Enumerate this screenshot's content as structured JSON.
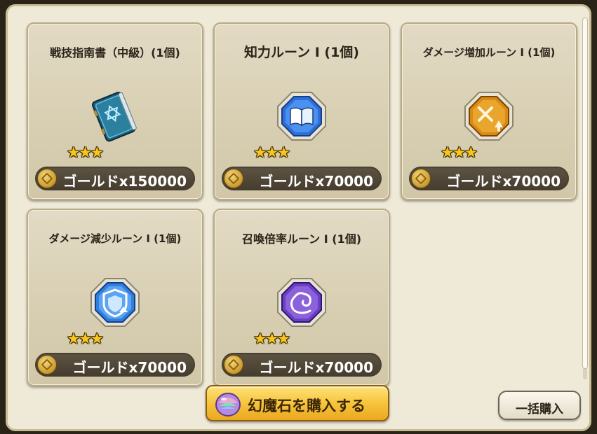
{
  "shop": {
    "items": [
      {
        "name": "戦技指南書（中級）(1個)",
        "stars": 3,
        "price": "ゴールドx150000",
        "icon": "blue-book-icon"
      },
      {
        "name": "知力ルーン I (1個)",
        "stars": 3,
        "price": "ゴールドx70000",
        "icon": "intellect-rune-icon"
      },
      {
        "name": "ダメージ増加ルーン I (1個)",
        "stars": 3,
        "price": "ゴールドx70000",
        "icon": "damage-up-rune-icon"
      },
      {
        "name": "ダメージ減少ルーン I (1個)",
        "stars": 3,
        "price": "ゴールドx70000",
        "icon": "damage-down-rune-icon"
      },
      {
        "name": "召喚倍率ルーン I (1個)",
        "stars": 3,
        "price": "ゴールドx70000",
        "icon": "summon-rate-rune-icon"
      }
    ],
    "star_glyphs": "★★★"
  },
  "footer": {
    "buy_gem_label": "幻魔石を購入する",
    "bulk_buy_label": "一括購入"
  },
  "colors": {
    "star": "#f7c51d",
    "price_bar": "#4e4537",
    "gold_button": "#f7c43c",
    "card_bg": "#d8cfb3"
  }
}
